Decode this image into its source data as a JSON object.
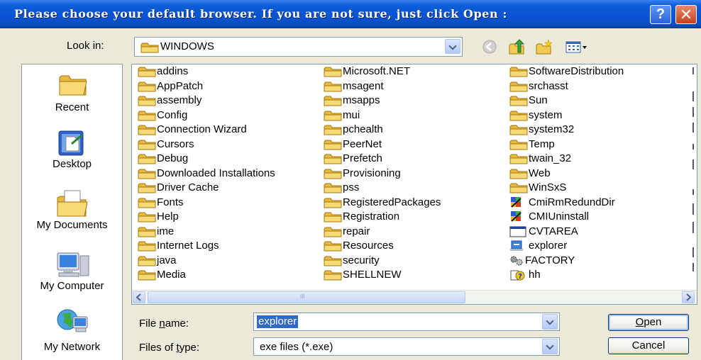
{
  "window": {
    "title": "Please choose your default browser. If you are not sure, just click Open :",
    "help_glyph": "?",
    "close_glyph": "✕"
  },
  "look_in": {
    "label": "Look in:",
    "value": "WINDOWS"
  },
  "places": [
    {
      "label": "Recent",
      "icon": "recent-folder-icon"
    },
    {
      "label": "Desktop",
      "icon": "desktop-icon"
    },
    {
      "label": "My Documents",
      "icon": "my-documents-icon"
    },
    {
      "label": "My Computer",
      "icon": "my-computer-icon"
    },
    {
      "label": "My Network",
      "icon": "my-network-icon"
    }
  ],
  "files": {
    "column1": [
      "addins",
      "AppPatch",
      "assembly",
      "Config",
      "Connection Wizard",
      "Cursors",
      "Debug",
      "Downloaded Installations",
      "Driver Cache",
      "Fonts",
      "Help",
      "ime",
      "Internet Logs",
      "java",
      "Media"
    ],
    "column2": [
      "Microsoft.NET",
      "msagent",
      "msapps",
      "mui",
      "pchealth",
      "PeerNet",
      "Prefetch",
      "Provisioning",
      "pss",
      "RegisteredPackages",
      "Registration",
      "repair",
      "Resources",
      "security",
      "SHELLNEW"
    ],
    "column3": [
      {
        "name": "SoftwareDistribution",
        "icon": "folder-icon"
      },
      {
        "name": "srchasst",
        "icon": "folder-icon"
      },
      {
        "name": "Sun",
        "icon": "folder-icon"
      },
      {
        "name": "system",
        "icon": "folder-icon"
      },
      {
        "name": "system32",
        "icon": "folder-icon"
      },
      {
        "name": "Temp",
        "icon": "folder-icon"
      },
      {
        "name": "twain_32",
        "icon": "folder-icon"
      },
      {
        "name": "Web",
        "icon": "folder-icon"
      },
      {
        "name": "WinSxS",
        "icon": "folder-icon"
      },
      {
        "name": "CmiRmRedundDir",
        "icon": "setup-program-icon"
      },
      {
        "name": "CMIUninstall",
        "icon": "setup-program-icon"
      },
      {
        "name": "CVTAREA",
        "icon": "window-app-icon"
      },
      {
        "name": "explorer",
        "icon": "explorer-app-icon"
      },
      {
        "name": "FACTORY",
        "icon": "gears-app-icon"
      },
      {
        "name": "hh",
        "icon": "help-app-icon"
      }
    ]
  },
  "scrollbar": {
    "grip": "III"
  },
  "file_name": {
    "label_pre": "File ",
    "label_u": "n",
    "label_post": "ame:",
    "value": "explorer"
  },
  "file_type": {
    "label_pre": "Files of ",
    "label_u": "t",
    "label_post": "ype:",
    "value": "exe files (*.exe)"
  },
  "buttons": {
    "open_u": "O",
    "open_rest": "pen",
    "cancel": "Cancel"
  },
  "colors": {
    "titlebar": "#0a54d4",
    "dialog_bg": "#ece9d8",
    "folder_yellow": "#f5d56c",
    "selection": "#316ac5"
  }
}
